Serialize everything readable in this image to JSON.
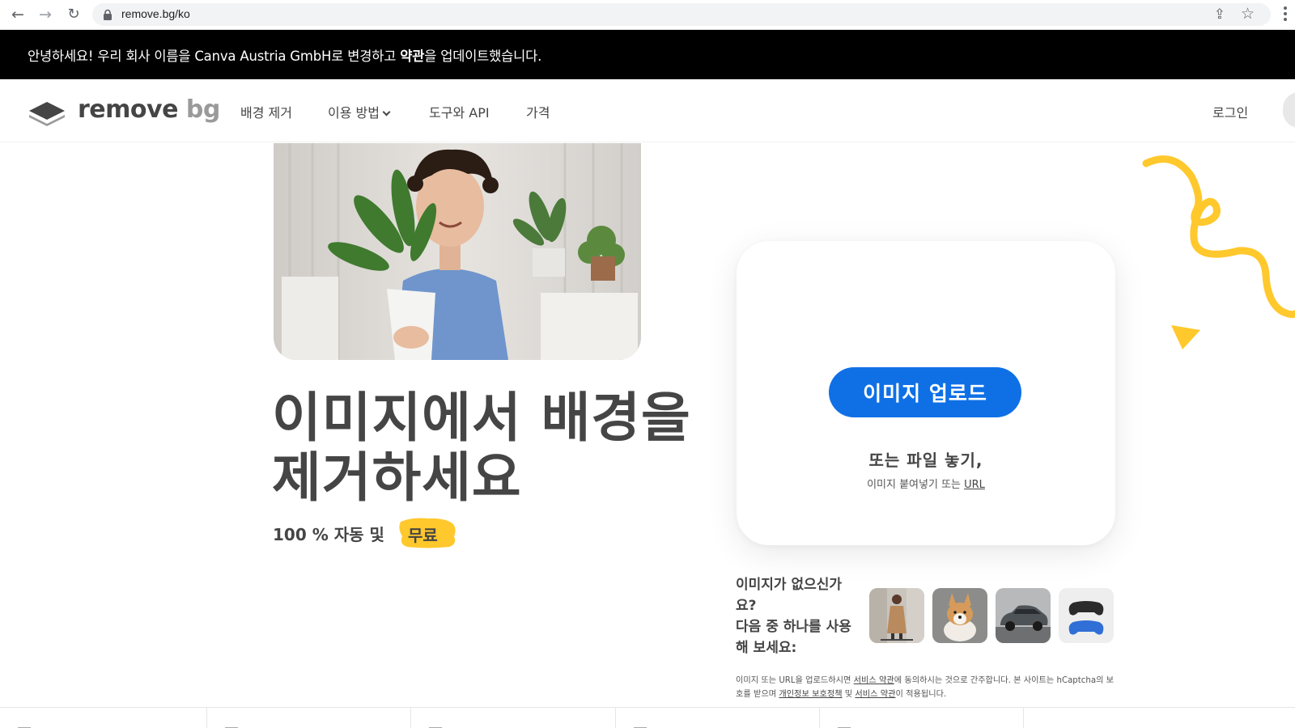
{
  "browser": {
    "url": "remove.bg/ko",
    "icons": [
      "back-arrow-icon",
      "forward-arrow-icon",
      "reload-icon",
      "lock-icon",
      "share-icon",
      "star-icon",
      "menu-dots-icon"
    ]
  },
  "banner": {
    "text_part1": "안녕하세요! 우리 회사 이름을 Canva Austria GmbH로 변경하고 ",
    "text_bold": "약관",
    "text_part2": "을 업데이트했습니다."
  },
  "header": {
    "logo_word_main": "remove",
    "logo_word_sub": "bg",
    "nav": [
      "배경 제거",
      "이용 방법",
      "도구와 API",
      "가격"
    ],
    "login": "로그인"
  },
  "hero": {
    "title_line1": "이미지에서 배경을",
    "title_line2": "제거하세요",
    "subtitle": "100 % 자동 및",
    "free_badge": "무료"
  },
  "upload": {
    "button": "이미지 업로드",
    "drop_text": "또는 파일 놓기,",
    "paste_text": "이미지 붙여넣기 또는 ",
    "url_link": "URL"
  },
  "samples": {
    "line1": "이미지가 없으신가",
    "line2": "요?",
    "line3": "다음 중 하나를 사용",
    "line4": "해 보세요:",
    "thumbs": [
      "woman-with-scooter",
      "corgi-dog",
      "gray-car",
      "game-controllers"
    ]
  },
  "legal": {
    "p1": "이미지 또는 URL을 업로드하시면 ",
    "link1": "서비스 약관",
    "p2": "에 동의하시는 것으로 간주합니다. 본 사이트는 hCaptcha의 보호를 받으며 ",
    "link2": "개인정보 보호정책",
    "p3": " 및 ",
    "link3": "서비스 약관",
    "p4": "이 적용됩니다."
  },
  "colors": {
    "primary_blue": "#0f70e6",
    "accent_yellow": "#ffc82c",
    "text_dark": "#454545",
    "banner_bg": "#000000"
  }
}
